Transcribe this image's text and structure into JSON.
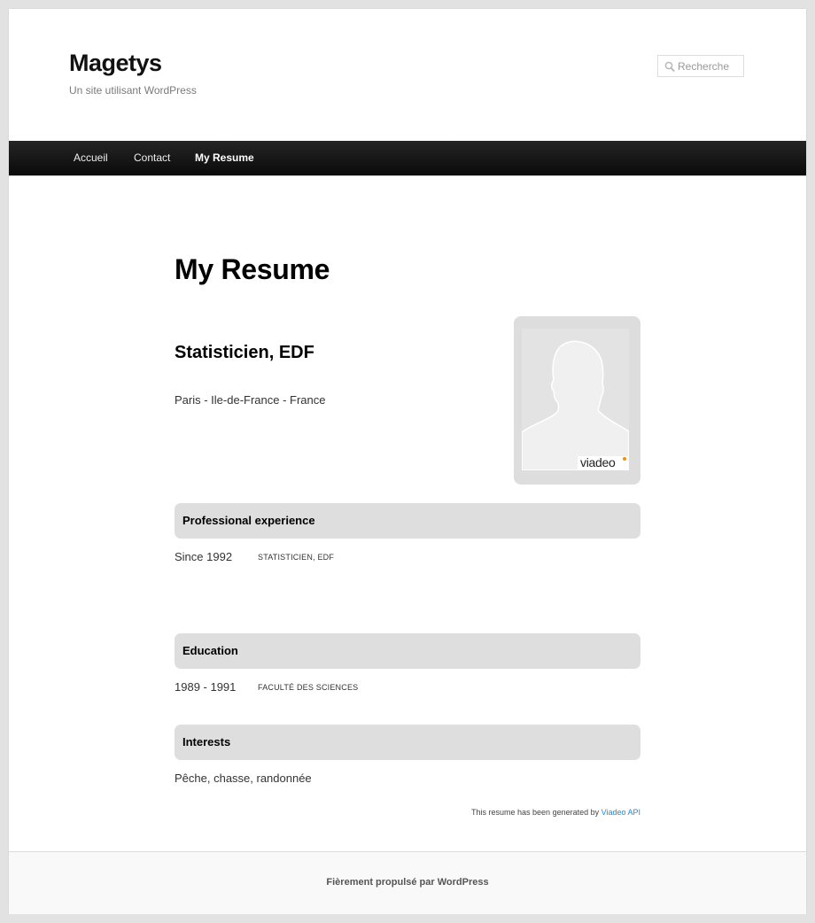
{
  "site": {
    "title": "Magetys",
    "description": "Un site utilisant WordPress"
  },
  "search": {
    "placeholder": "Recherche",
    "icon": "search-icon"
  },
  "nav": {
    "items": [
      {
        "label": "Accueil",
        "current": false
      },
      {
        "label": "Contact",
        "current": false
      },
      {
        "label": "My Resume",
        "current": true
      }
    ]
  },
  "page": {
    "title": "My Resume"
  },
  "resume": {
    "headline": "Statisticien, EDF",
    "location": "Paris - Ile-de-France - France",
    "photo": {
      "icon": "profile-silhouette-icon",
      "logo_text": "viadeo"
    },
    "experience": {
      "heading": "Professional experience",
      "entries": [
        {
          "date": "Since 1992",
          "title": "Statisticien, EDF"
        }
      ]
    },
    "education": {
      "heading": "Education",
      "entries": [
        {
          "date": "1989 - 1991",
          "title": "Faculté des Sciences"
        }
      ]
    },
    "interests": {
      "heading": "Interests",
      "text": "Pêche, chasse, randonnée"
    },
    "generated_text": "This resume has been generated by",
    "generated_link": "Viadeo API"
  },
  "footer": {
    "text": "Fièrement propulsé par WordPress"
  },
  "colors": {
    "link": "#1b8be0",
    "nav_bg": "#111111",
    "section_bg": "#dedede",
    "viadeo_dot": "#f29200"
  }
}
